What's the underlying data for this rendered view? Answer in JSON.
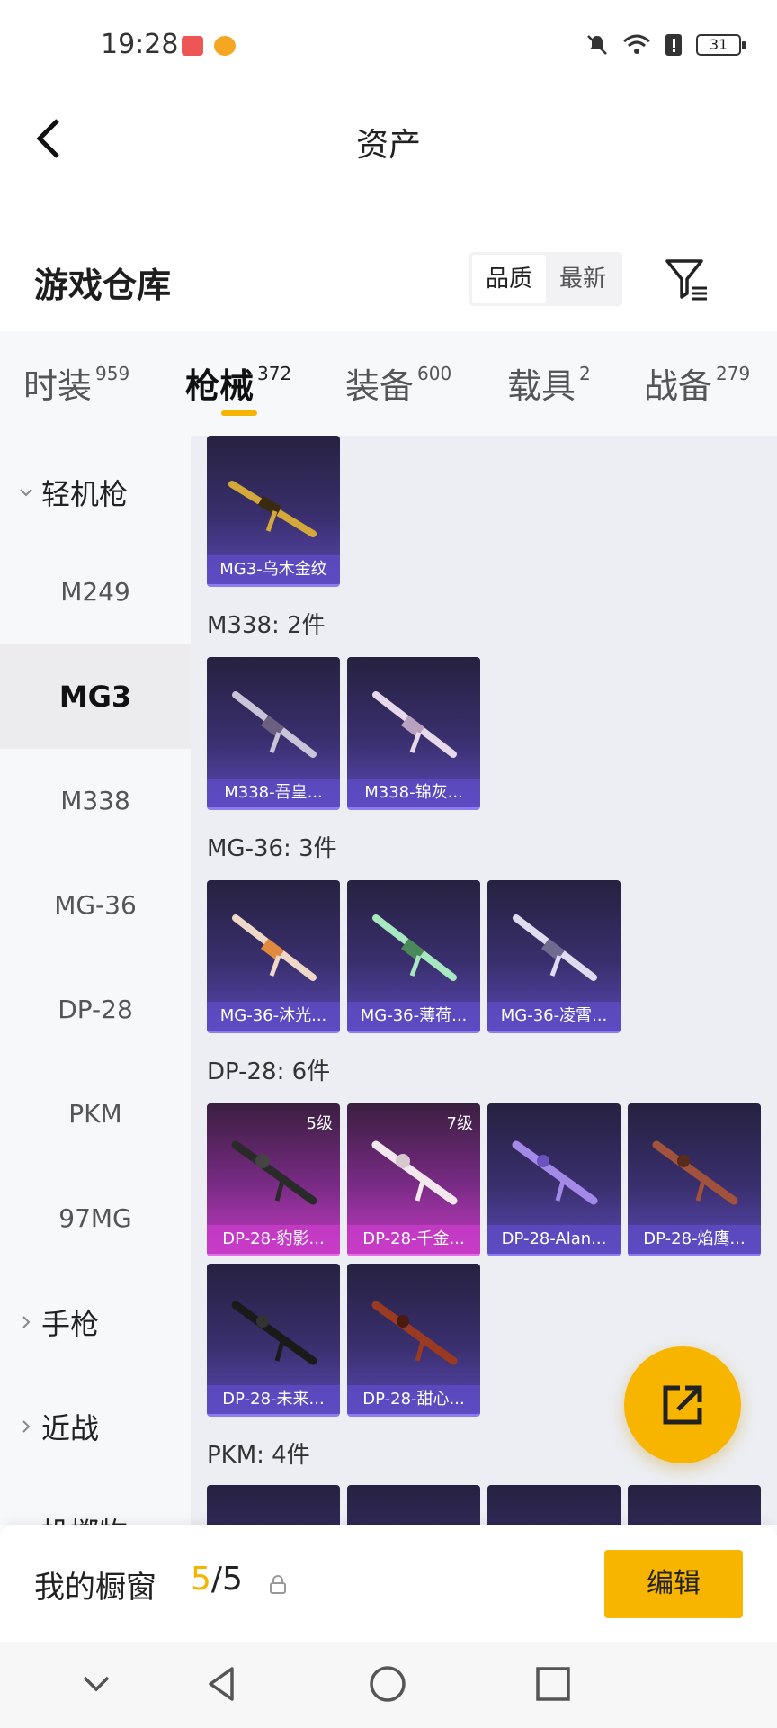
{
  "status_bar": {
    "time": "19:28",
    "battery": "31"
  },
  "header": {
    "title": "资产"
  },
  "section": {
    "title": "游戏仓库",
    "sort_options": [
      "品质",
      "最新"
    ],
    "active_sort": "品质"
  },
  "tabs": [
    {
      "label": "时装",
      "count": "959"
    },
    {
      "label": "枪械",
      "count": "372"
    },
    {
      "label": "装备",
      "count": "600"
    },
    {
      "label": "载具",
      "count": "2"
    },
    {
      "label": "战备",
      "count": "279"
    }
  ],
  "active_tab": "枪械",
  "sidebar": {
    "group_lmg": "轻机枪",
    "items": [
      "M249",
      "MG3",
      "M338",
      "MG-36",
      "DP-28",
      "PKM",
      "97MG"
    ],
    "active_item": "MG3",
    "group_pistol": "手枪",
    "group_melee": "近战",
    "group_throwable": "投掷物"
  },
  "content": {
    "groups": [
      {
        "label": "",
        "items": [
          {
            "name": "MG3-乌木金纹"
          }
        ]
      },
      {
        "label": "M338: 2件",
        "items": [
          {
            "name": "M338-吾皇..."
          },
          {
            "name": "M338-锦灰..."
          }
        ]
      },
      {
        "label": "MG-36: 3件",
        "items": [
          {
            "name": "MG-36-沐光..."
          },
          {
            "name": "MG-36-薄荷..."
          },
          {
            "name": "MG-36-凌霄..."
          }
        ]
      },
      {
        "label": "DP-28: 6件",
        "items": [
          {
            "name": "DP-28-豹影...",
            "level": "5级"
          },
          {
            "name": "DP-28-千金...",
            "level": "7级"
          },
          {
            "name": "DP-28-Alan..."
          },
          {
            "name": "DP-28-焰鹰..."
          },
          {
            "name": "DP-28-未来..."
          },
          {
            "name": "DP-28-甜心..."
          }
        ]
      },
      {
        "label": "PKM: 4件",
        "items": []
      }
    ]
  },
  "bottom": {
    "showcase_label": "我的橱窗",
    "showcase_current": "5",
    "showcase_total": "/5",
    "edit_label": "编辑"
  },
  "colors": {
    "accent": "#f7b500",
    "card_purple": "#5a48b4",
    "card_pink": "#c43cc4"
  },
  "icons": [
    "back-arrow-icon",
    "filter-icon",
    "external-link-icon",
    "lock-icon",
    "chevron-down-icon",
    "chevron-right-icon"
  ]
}
